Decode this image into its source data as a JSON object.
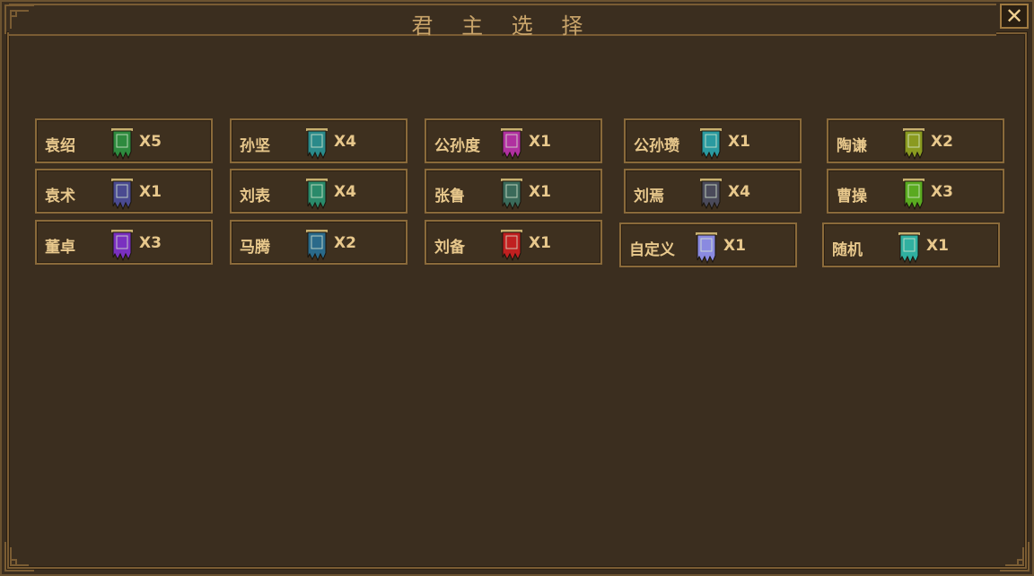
{
  "window": {
    "title": "君 主 选 择",
    "close_label": "✕"
  },
  "colors": {
    "background": "#3b2e1f",
    "border": "#8a6a3a",
    "text": "#e8c88c",
    "title": "#c9a46a"
  },
  "rulers": [
    {
      "name": "袁绍",
      "count": "X5",
      "flag_color": "#2e8a3e",
      "flag_char": "袁",
      "icon": "green-banner-icon"
    },
    {
      "name": "孙坚",
      "count": "X4",
      "flag_color": "#2a8a8a",
      "flag_char": "孙",
      "icon": "teal-banner-icon"
    },
    {
      "name": "公孙度",
      "count": "X1",
      "flag_color": "#b030a0",
      "flag_char": "公",
      "icon": "magenta-banner-icon"
    },
    {
      "name": "公孙瓒",
      "count": "X1",
      "flag_color": "#2a9aa0",
      "flag_char": "公",
      "icon": "cyan-banner-icon"
    },
    {
      "name": "陶谦",
      "count": "X2",
      "flag_color": "#8a9a20",
      "flag_char": "陶",
      "icon": "olive-banner-icon"
    },
    {
      "name": "袁术",
      "count": "X1",
      "flag_color": "#4a4a90",
      "flag_char": "袁",
      "icon": "indigo-banner-icon"
    },
    {
      "name": "刘表",
      "count": "X4",
      "flag_color": "#2a8a6a",
      "flag_char": "刘",
      "icon": "seagreen-banner-icon"
    },
    {
      "name": "张鲁",
      "count": "X1",
      "flag_color": "#3a6a5a",
      "flag_char": "张",
      "icon": "darkteal-banner-icon"
    },
    {
      "name": "刘焉",
      "count": "X4",
      "flag_color": "#4a4a5a",
      "flag_char": "刘",
      "icon": "gray-banner-icon"
    },
    {
      "name": "曹操",
      "count": "X3",
      "flag_color": "#5aaa20",
      "flag_char": "曹",
      "icon": "lime-banner-icon"
    },
    {
      "name": "董卓",
      "count": "X3",
      "flag_color": "#7a30c0",
      "flag_char": "董",
      "icon": "purple-banner-icon"
    },
    {
      "name": "马腾",
      "count": "X2",
      "flag_color": "#2a6a8a",
      "flag_char": "马",
      "icon": "blue-banner-icon"
    },
    {
      "name": "刘备",
      "count": "X1",
      "flag_color": "#c02020",
      "flag_char": "刘",
      "icon": "red-banner-icon"
    },
    {
      "name": "自定义",
      "count": "X1",
      "flag_color": "#8a8ae0",
      "flag_char": "",
      "icon": "lavender-banner-icon"
    },
    {
      "name": "随机",
      "count": "X1",
      "flag_color": "#30b0a0",
      "flag_char": "",
      "icon": "aqua-banner-icon"
    }
  ]
}
